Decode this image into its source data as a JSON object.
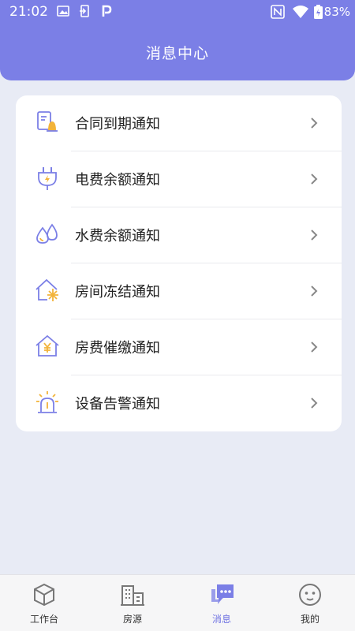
{
  "status_bar": {
    "time": "21:02",
    "battery": "83%"
  },
  "header": {
    "title": "消息中心"
  },
  "notifications": [
    {
      "label": "合同到期通知",
      "icon": "contract-bell-icon"
    },
    {
      "label": "电费余额通知",
      "icon": "electric-plug-icon"
    },
    {
      "label": "水费余额通知",
      "icon": "water-drops-icon"
    },
    {
      "label": "房间冻结通知",
      "icon": "house-snowflake-icon"
    },
    {
      "label": "房费催缴通知",
      "icon": "house-yen-icon"
    },
    {
      "label": "设备告警通知",
      "icon": "alarm-light-icon"
    }
  ],
  "tabbar": {
    "items": [
      {
        "label": "工作台",
        "icon": "cube-icon",
        "active": false
      },
      {
        "label": "房源",
        "icon": "building-icon",
        "active": false
      },
      {
        "label": "消息",
        "icon": "chat-bubbles-icon",
        "active": true
      },
      {
        "label": "我的",
        "icon": "face-icon",
        "active": false
      }
    ]
  },
  "colors": {
    "accent": "#7b7fe6",
    "icon_yellow": "#f2b33a",
    "background": "#e8ebf5"
  }
}
